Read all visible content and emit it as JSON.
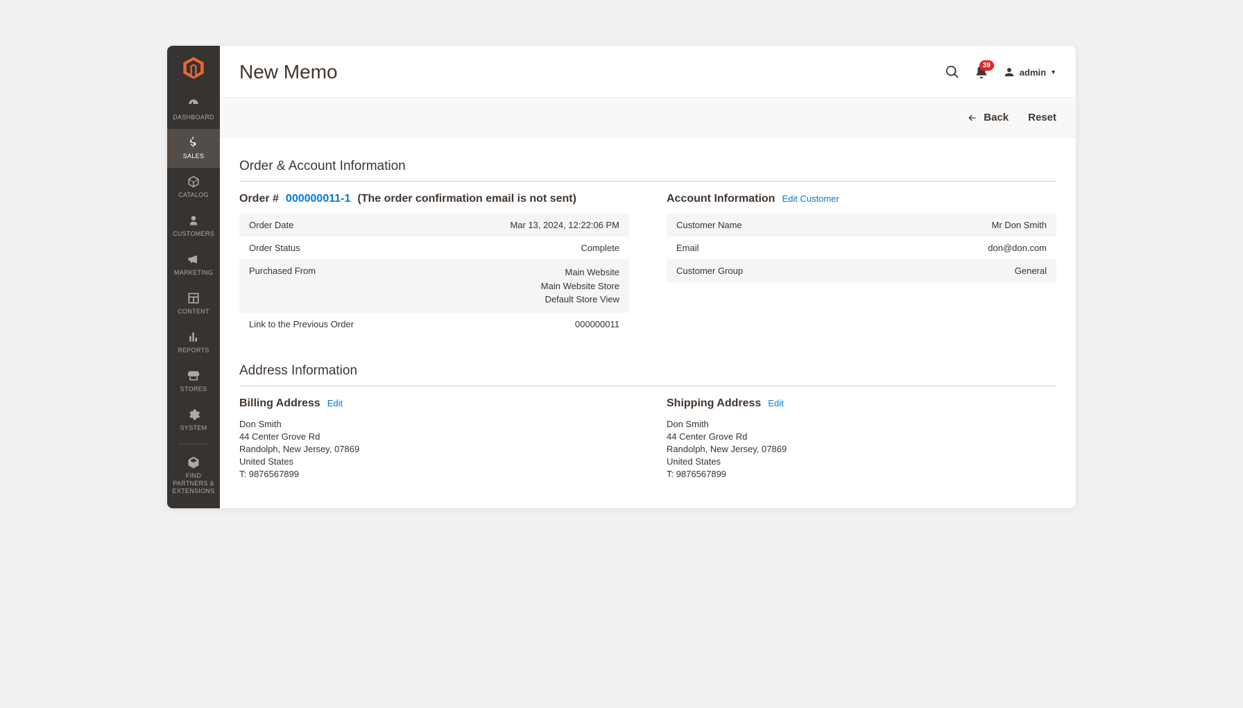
{
  "page_title": "New Memo",
  "notification_count": "39",
  "user_name": "admin",
  "sidebar": {
    "items": [
      {
        "label": "DASHBOARD"
      },
      {
        "label": "SALES"
      },
      {
        "label": "CATALOG"
      },
      {
        "label": "CUSTOMERS"
      },
      {
        "label": "MARKETING"
      },
      {
        "label": "CONTENT"
      },
      {
        "label": "REPORTS"
      },
      {
        "label": "STORES"
      },
      {
        "label": "SYSTEM"
      },
      {
        "label": "FIND PARTNERS & EXTENSIONS"
      }
    ]
  },
  "actions": {
    "back": "Back",
    "reset": "Reset"
  },
  "section1_title": "Order & Account Information",
  "order_header": {
    "prefix": "Order # ",
    "number": "000000011-1",
    "note": " (The order confirmation email is not sent)"
  },
  "order_info": {
    "rows": [
      {
        "label": "Order Date",
        "value": "Mar 13, 2024, 12:22:06 PM",
        "link": false
      },
      {
        "label": "Order Status",
        "value": "Complete",
        "link": false
      },
      {
        "label": "Purchased From",
        "value": "Main Website\nMain Website Store\nDefault Store View",
        "link": false
      },
      {
        "label": "Link to the Previous Order",
        "value": "000000011",
        "link": true
      }
    ]
  },
  "account_header": {
    "title": "Account Information",
    "edit": "Edit Customer"
  },
  "account_info": {
    "rows": [
      {
        "label": "Customer Name",
        "value": "Mr Don Smith",
        "link": true
      },
      {
        "label": "Email",
        "value": "don@don.com",
        "link": true
      },
      {
        "label": "Customer Group",
        "value": "General",
        "link": false
      }
    ]
  },
  "section2_title": "Address Information",
  "billing": {
    "title": "Billing Address",
    "edit": "Edit",
    "lines": [
      "Don Smith",
      "44 Center Grove Rd",
      "Randolph, New Jersey, 07869",
      "United States",
      "T: 9876567899"
    ]
  },
  "shipping": {
    "title": "Shipping Address",
    "edit": "Edit",
    "lines": [
      "Don Smith",
      "44 Center Grove Rd",
      "Randolph, New Jersey, 07869",
      "United States",
      "T: 9876567899"
    ]
  }
}
